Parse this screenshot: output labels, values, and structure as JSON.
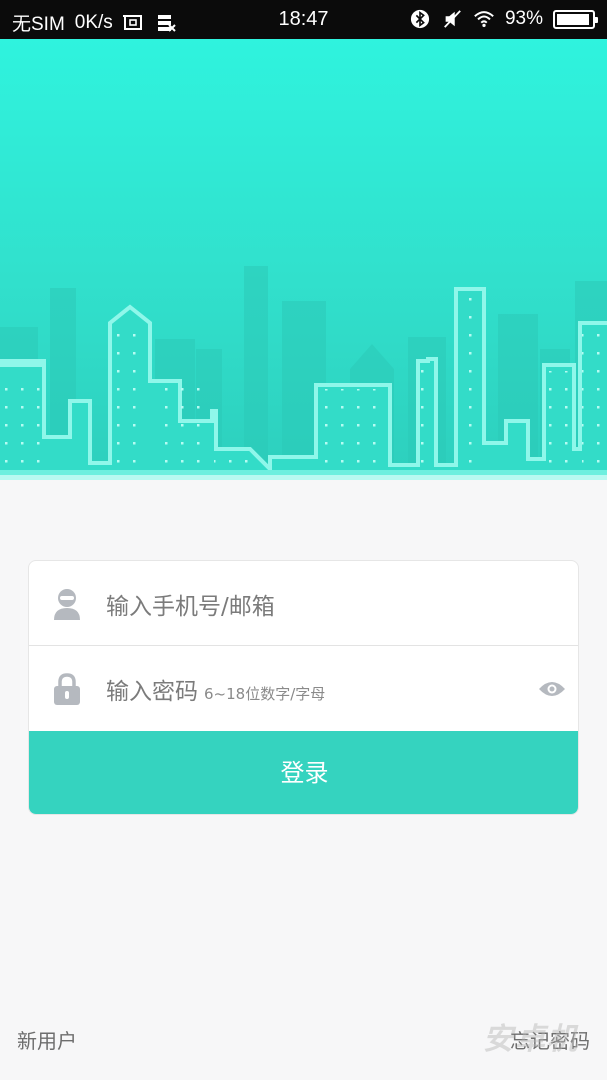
{
  "status_bar": {
    "carrier": "无SIM",
    "speed": "0K/s",
    "time": "18:47",
    "battery": "93%",
    "battery_level": 0.93,
    "icons": [
      "screenshot-icon",
      "data-saver-icon",
      "bluetooth-icon",
      "silent-icon",
      "wifi-icon",
      "battery-icon"
    ]
  },
  "login": {
    "username_placeholder": "输入手机号/邮箱",
    "password_placeholder": "输入密码",
    "password_hint": "6~18位数字/字母",
    "submit_label": "登录"
  },
  "footer": {
    "new_user": "新用户",
    "forgot_password": "忘记密码",
    "watermark": "安卓机"
  },
  "colors": {
    "accent": "#35d3bf",
    "hero_top": "#2ff3de",
    "hero_bottom": "#2dcfbd",
    "skyline_outline": "#8ff7ea",
    "status_bar": "#0b0b0b"
  }
}
